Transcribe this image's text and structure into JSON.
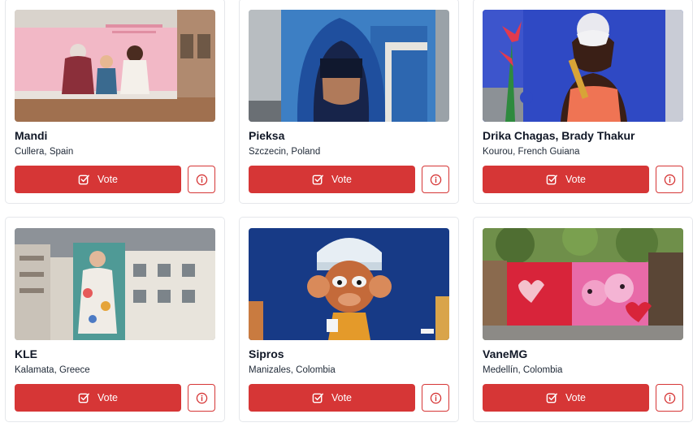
{
  "theme": {
    "accent": "#d63636",
    "card_border": "#e5e7eb"
  },
  "vote_icon": "checkbox-check-icon",
  "info_icon": "info-circle-icon",
  "cards": [
    {
      "artist": "Mandi",
      "location": "Cullera, Spain",
      "vote_label": "Vote",
      "image": "mural-women-and-child-pink-wall"
    },
    {
      "artist": "Pieksa",
      "location": "Szczecin, Poland",
      "vote_label": "Vote",
      "image": "mural-blue-hooded-face"
    },
    {
      "artist": "Drika Chagas, Brady Thakur",
      "location": "Kourou, French Guiana",
      "vote_label": "Vote",
      "image": "mural-masked-woman-with-trumpet"
    },
    {
      "artist": "KLE",
      "location": "Kalamata, Greece",
      "vote_label": "Vote",
      "image": "mural-woman-in-floral-dress-on-building"
    },
    {
      "artist": "Sipros",
      "location": "Manizales, Colombia",
      "vote_label": "Vote",
      "image": "mural-cartoon-monkey-with-cup"
    },
    {
      "artist": "VaneMG",
      "location": "Medellín, Colombia",
      "vote_label": "Vote",
      "image": "mural-pink-cats-and-hearts-wall"
    }
  ]
}
